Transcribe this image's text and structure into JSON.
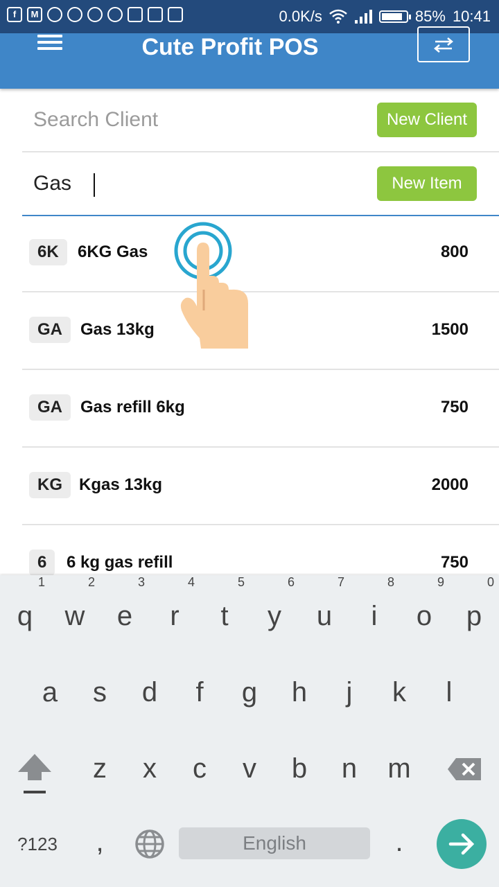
{
  "status_bar": {
    "left_icons": [
      "facebook-icon",
      "gmail-icon",
      "shield-icon",
      "app-icon",
      "chat-icon",
      "whatsapp-icon",
      "keyboard-icon",
      "cast-icon",
      "calendar-icon"
    ],
    "net_speed": "0.0K/s",
    "battery": "85%",
    "time": "10:41",
    "battery_level": 0.85
  },
  "header": {
    "title": "Cute Profit POS"
  },
  "client_field": {
    "placeholder": "Search Client",
    "button": "New Client"
  },
  "item_field": {
    "value": "Gas",
    "button": "New Item"
  },
  "items": [
    {
      "code": "6K",
      "name": "6KG Gas",
      "price": "800"
    },
    {
      "code": "GA",
      "name": "Gas 13kg",
      "price": "1500"
    },
    {
      "code": "GA",
      "name": "Gas refill 6kg",
      "price": "750"
    },
    {
      "code": "KG",
      "name": "Kgas 13kg",
      "price": "2000"
    },
    {
      "code": "6",
      "name": "6 kg gas refill",
      "price": "750"
    }
  ],
  "keyboard": {
    "row1": [
      "q",
      "w",
      "e",
      "r",
      "t",
      "y",
      "u",
      "i",
      "o",
      "p"
    ],
    "row1_numbers": [
      "1",
      "2",
      "3",
      "4",
      "5",
      "6",
      "7",
      "8",
      "9",
      "0"
    ],
    "row2": [
      "a",
      "s",
      "d",
      "f",
      "g",
      "h",
      "j",
      "k",
      "l"
    ],
    "row3": [
      "z",
      "x",
      "c",
      "v",
      "b",
      "n",
      "m"
    ],
    "symbols": "?123",
    "comma": ",",
    "space": "English",
    "period": "."
  },
  "colors": {
    "status_bar": "#234a7c",
    "app_bar": "#3f86c8",
    "green_button": "#8dc63f",
    "enter_key": "#3bafa1"
  }
}
